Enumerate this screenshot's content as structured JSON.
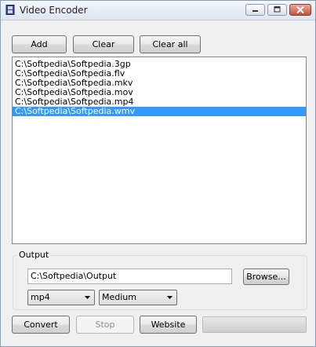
{
  "window": {
    "title": "Video Encoder"
  },
  "toolbar": {
    "add_label": "Add",
    "clear_label": "Clear",
    "clear_all_label": "Clear all"
  },
  "files": [
    {
      "path": "C:\\Softpedia\\Softpedia.3gp",
      "selected": false
    },
    {
      "path": "C:\\Softpedia\\Softpedia.flv",
      "selected": false
    },
    {
      "path": "C:\\Softpedia\\Softpedia.mkv",
      "selected": false
    },
    {
      "path": "C:\\Softpedia\\Softpedia.mov",
      "selected": false
    },
    {
      "path": "C:\\Softpedia\\Softpedia.mp4",
      "selected": false
    },
    {
      "path": "C:\\Softpedia\\Softpedia.wmv",
      "selected": true
    }
  ],
  "output": {
    "group_label": "Output",
    "folder_value": "C:\\Softpedia\\Output",
    "browse_label": "Browse...",
    "format_selected": "mp4",
    "quality_selected": "Medium"
  },
  "actions": {
    "convert_label": "Convert",
    "stop_label": "Stop",
    "stop_enabled": false,
    "website_label": "Website"
  },
  "progress": {
    "fraction": 0
  },
  "colors": {
    "selection": "#3399ff",
    "close_button": "#c6513d"
  },
  "icons": {
    "app": "film-icon",
    "minimize": "minimize-icon",
    "maximize": "maximize-icon",
    "close": "close-icon",
    "dropdown": "chevron-down-icon"
  }
}
